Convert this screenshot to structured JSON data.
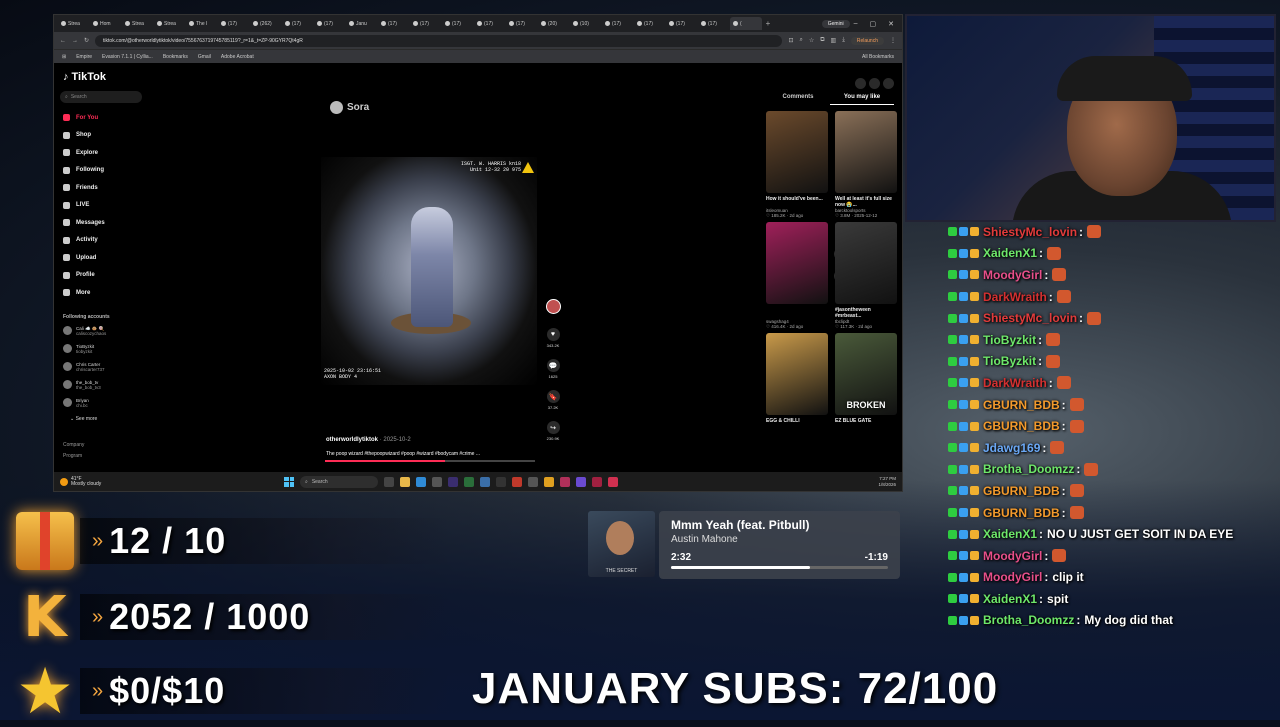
{
  "browser": {
    "tabs": [
      "Strea",
      "Hom",
      "Strea",
      "Strea",
      "The l",
      "(17)",
      "(262)",
      "(17)",
      "(17)",
      "Janu",
      "(17)",
      "(17)",
      "(17)",
      "(17)",
      "(17)",
      "(20)",
      "(10)",
      "(17)",
      "(17)",
      "(17)",
      "(17)",
      "("
    ],
    "gemini_label": "Gemini",
    "url": "tiktok.com/@otherworldlytiktok/video/7556763719745785119?_r=1&_t=ZP-90GYR7Qt4gR",
    "relaunch_label": "Relaunch",
    "bookmarks": [
      "Empire",
      "Evasion 7.1.1 | Cyllia...",
      "Bookmarks",
      "Gmail",
      "Adobe Acrobat"
    ],
    "all_bookmarks": "All Bookmarks"
  },
  "tiktok": {
    "logo": "TikTok",
    "search_placeholder": "Search",
    "nav": [
      {
        "label": "For You",
        "icon": "home-icon"
      },
      {
        "label": "Shop",
        "icon": "shop-icon"
      },
      {
        "label": "Explore",
        "icon": "compass-icon"
      },
      {
        "label": "Following",
        "icon": "following-icon"
      },
      {
        "label": "Friends",
        "icon": "friends-icon"
      },
      {
        "label": "LIVE",
        "icon": "live-icon"
      },
      {
        "label": "Messages",
        "icon": "messages-icon"
      },
      {
        "label": "Activity",
        "icon": "activity-icon"
      },
      {
        "label": "Upload",
        "icon": "upload-icon"
      },
      {
        "label": "Profile",
        "icon": "profile-icon"
      },
      {
        "label": "More",
        "icon": "more-icon"
      }
    ],
    "following_title": "Following accounts",
    "following": [
      {
        "name": "Cali ☁️ 🐵 🍭",
        "handle": "caliscozychaos"
      },
      {
        "name": "TioByzkit",
        "handle": "tiobyzkit"
      },
      {
        "name": "Chris Carter",
        "handle": "chriscarter737"
      },
      {
        "name": "the_bob_tv",
        "handle": "the_bob_tv3"
      },
      {
        "name": "Briyan",
        "handle": "chi.bc"
      }
    ],
    "see_more": "See more",
    "footer": [
      "Company",
      "Program"
    ],
    "sora_label": "Sora",
    "video_osd_top": [
      "ISGT. W. HARRIS kn18",
      "Unit 12-32 20 975"
    ],
    "video_osd_bottom": [
      "2025-10-02 23:16:51",
      "AXON BODY 4"
    ],
    "actions": [
      {
        "icon": "heart-icon",
        "count": "343.2K"
      },
      {
        "icon": "comment-icon",
        "count": "1625"
      },
      {
        "icon": "bookmark-icon",
        "count": "37.2K"
      },
      {
        "icon": "share-icon",
        "count": "230.9K"
      }
    ],
    "author": "otherworldlytiktok",
    "date": "· 2025-10-2",
    "caption": "The poop wizard #thepoopwizard #poop #wizard #bodycam #crime ...",
    "progress_fraction": 0.57,
    "right_tabs": [
      "Comments",
      "You may like"
    ],
    "cards": [
      {
        "title": "How it should've been...",
        "user": "itsleomuan",
        "meta": "♡ 185.2K · 2d ago",
        "color": "#6b4a2c",
        "overlay": ""
      },
      {
        "title": "Well at least it's full size now 😭...",
        "user": "barcktoolsports",
        "meta": "♡ 3.8M · 2025-12-12",
        "color": "#8a7058",
        "overlay": ""
      },
      {
        "title": "",
        "user": "swagshag4",
        "meta": "♡ 416.4K · 2d ago",
        "color": "#a0205a",
        "overlay": ""
      },
      {
        "title": "#jasontheween #mrbeast...",
        "user": "tbclipdt",
        "meta": "♡ 117.3K · 2d ago",
        "color": "#3a3a3a",
        "overlay": ""
      },
      {
        "title": "EGG & CHILLI",
        "user": "",
        "meta": "",
        "color": "#c99a4a",
        "overlay": ""
      },
      {
        "title": "EZ BLUE GATE",
        "user": "",
        "meta": "",
        "color": "#4a5a3a",
        "overlay": "BROKEN"
      }
    ]
  },
  "taskbar": {
    "weather_temp": "41°F",
    "weather_desc": "Mostly cloudy",
    "search_label": "Search",
    "time": "7:27 PM",
    "date": "1/8/2026"
  },
  "chat": [
    {
      "user": "ShiestyMc_lovin",
      "color": "#e23b3b",
      "msg": "",
      "emote": true
    },
    {
      "user": "XaidenX1",
      "color": "#6ee86a",
      "msg": "",
      "emote": true
    },
    {
      "user": "MoodyGirl",
      "color": "#e84f8a",
      "msg": "",
      "emote": true
    },
    {
      "user": "DarkWraith",
      "color": "#d43030",
      "msg": "",
      "emote": true
    },
    {
      "user": "ShiestyMc_lovin",
      "color": "#e23b3b",
      "msg": "",
      "emote": true
    },
    {
      "user": "TioByzkit",
      "color": "#6ee86a",
      "msg": "",
      "emote": true
    },
    {
      "user": "TioByzkit",
      "color": "#6ee86a",
      "msg": "",
      "emote": true
    },
    {
      "user": "DarkWraith",
      "color": "#d43030",
      "msg": "",
      "emote": true
    },
    {
      "user": "GBURN_BDB",
      "color": "#f39a2c",
      "msg": "",
      "emote": true
    },
    {
      "user": "GBURN_BDB",
      "color": "#f39a2c",
      "msg": "",
      "emote": true
    },
    {
      "user": "Jdawg169",
      "color": "#6aa8f5",
      "msg": "",
      "emote": true
    },
    {
      "user": "Brotha_Doomzz",
      "color": "#6ee86a",
      "msg": "",
      "emote": true
    },
    {
      "user": "GBURN_BDB",
      "color": "#f39a2c",
      "msg": "",
      "emote": true
    },
    {
      "user": "GBURN_BDB",
      "color": "#f39a2c",
      "msg": "",
      "emote": true
    },
    {
      "user": "XaidenX1",
      "color": "#6ee86a",
      "msg": "NO U JUST GET SOIT IN DA EYE",
      "emote": false
    },
    {
      "user": "MoodyGirl",
      "color": "#e84f8a",
      "msg": "",
      "emote": true
    },
    {
      "user": "MoodyGirl",
      "color": "#e84f8a",
      "msg": "clip it",
      "emote": false
    },
    {
      "user": "XaidenX1",
      "color": "#6ee86a",
      "msg": "spit",
      "emote": false
    },
    {
      "user": "Brotha_Doomzz",
      "color": "#6ee86a",
      "msg": "My dog did that",
      "emote": false
    }
  ],
  "goals": [
    {
      "icon": "gift-icon",
      "value": "12 / 10"
    },
    {
      "icon": "kick-logo-icon",
      "value": "2052 / 1000"
    },
    {
      "icon": "star-icon",
      "value": "$0/$10"
    }
  ],
  "song": {
    "title": "Mmm Yeah (feat. Pitbull)",
    "artist": "Austin Mahone",
    "elapsed": "2:32",
    "remaining": "-1:19",
    "progress_fraction": 0.64,
    "album_caption": "THE SECRET"
  },
  "subs_goal": "JANUARY SUBS: 72/100"
}
